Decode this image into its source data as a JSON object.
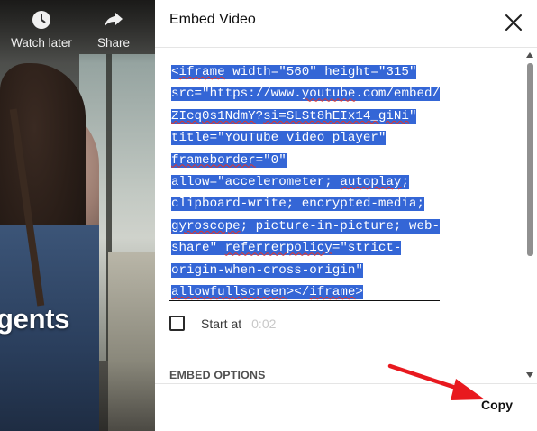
{
  "video": {
    "watch_later_label": "Watch later",
    "share_label": "Share",
    "title_fragment": "gents",
    "watch_later_icon": "clock-icon",
    "share_icon": "share-arrow-icon"
  },
  "dialog": {
    "title": "Embed Video",
    "close_icon": "close-icon",
    "code_lines": [
      "<iframe width=\"560\" height=\"315\"",
      "src=\"https://www.youtube.com/embed/",
      "ZIcq0s1NdmY?si=SLSt8hEIx14_giNi\"",
      "title=\"YouTube video player\"",
      "frameborder=\"0\"",
      "allow=\"accelerometer; autoplay;",
      "clipboard-write; encrypted-media;",
      "gyroscope; picture-in-picture; web-",
      "share\" referrerpolicy=\"strict-",
      "origin-when-cross-origin\"",
      "allowfullscreen></iframe>"
    ],
    "start_at_label": "Start at",
    "start_at_time": "0:02",
    "start_at_checked": false,
    "embed_options_label": "EMBED OPTIONS",
    "copy_label": "Copy"
  },
  "colors": {
    "selection": "#3466d6",
    "annotation_arrow": "#e8191f"
  }
}
